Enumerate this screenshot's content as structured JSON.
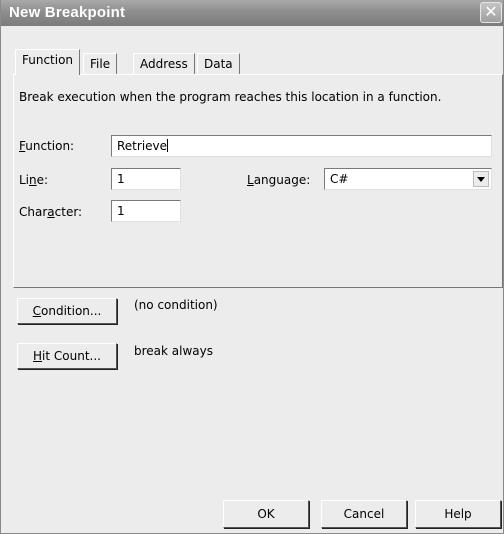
{
  "window": {
    "title": "New Breakpoint"
  },
  "tabs": [
    {
      "label": "Function",
      "active": true
    },
    {
      "label": "File"
    },
    {
      "label": "Address"
    },
    {
      "label": "Data"
    }
  ],
  "function_tab": {
    "description": "Break execution when the program reaches this location in a function.",
    "function_label": "Function:",
    "function_value": "Retrieve",
    "line_label": "Line:",
    "line_value": "1",
    "character_label": "Character:",
    "character_value": "1",
    "language_label": "Language:",
    "language_value": "C#"
  },
  "condition": {
    "button_label": "Condition...",
    "status": "(no condition)"
  },
  "hit_count": {
    "button_label": "Hit Count...",
    "status": "break always"
  },
  "footer": {
    "ok": "OK",
    "cancel": "Cancel",
    "help": "Help"
  },
  "icons": {
    "close": "close-icon",
    "dropdown": "chevron-down-icon"
  }
}
